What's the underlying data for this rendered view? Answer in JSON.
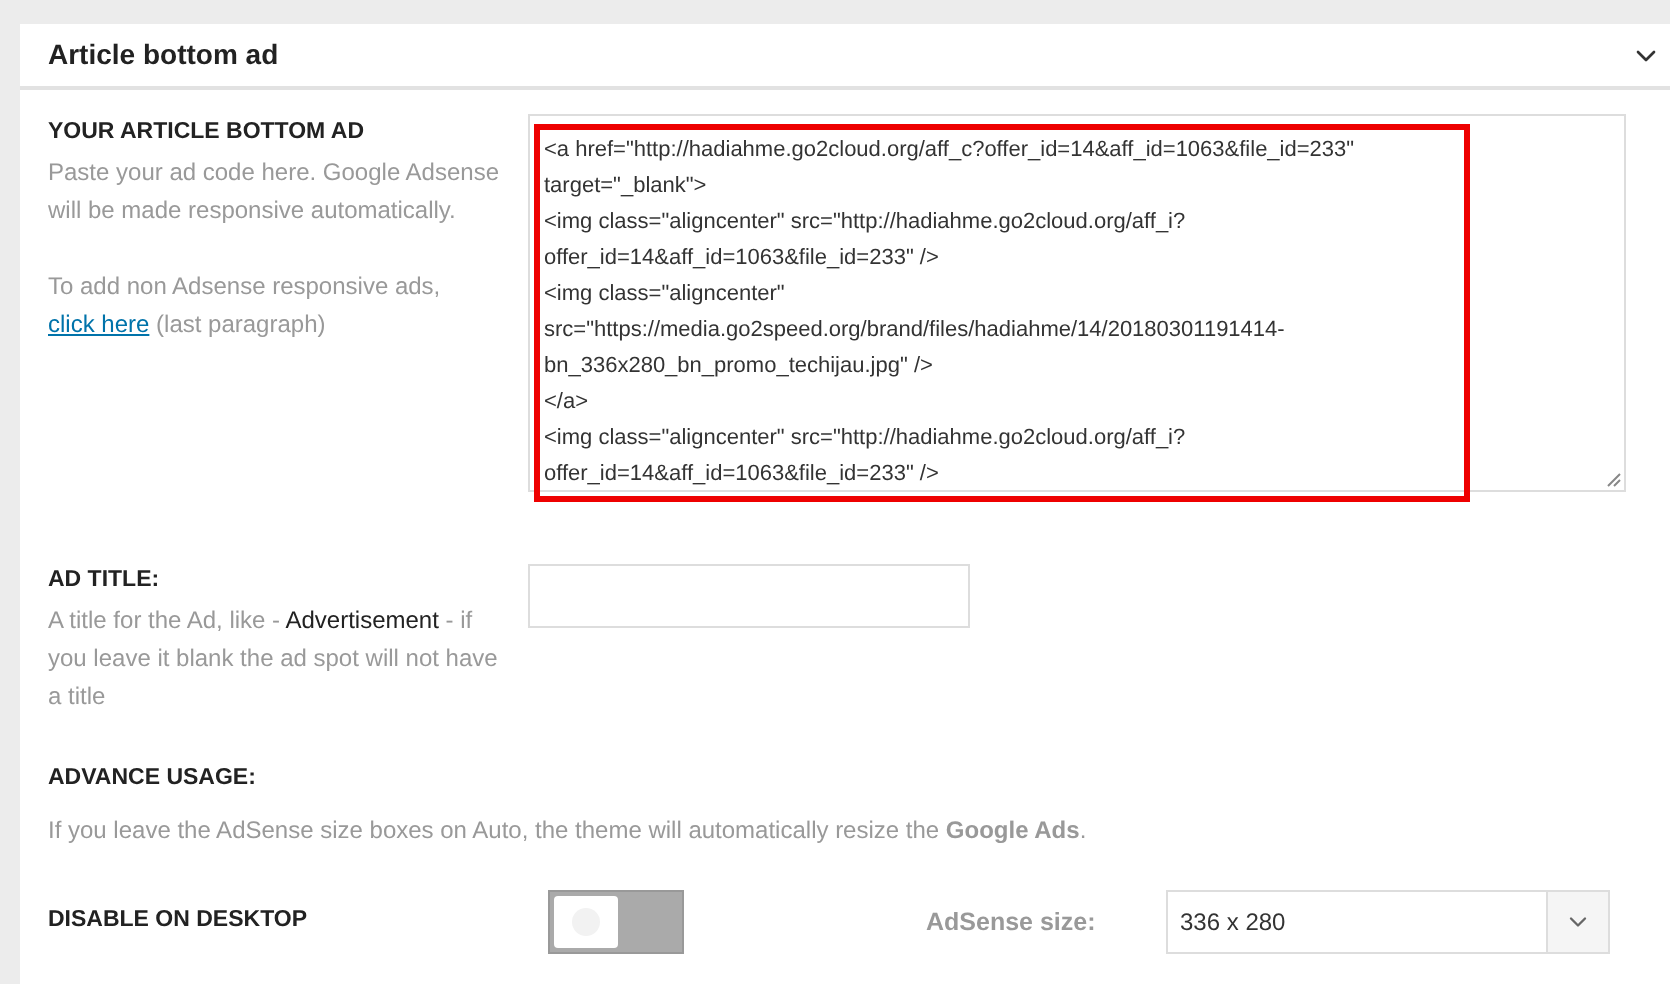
{
  "panel": {
    "title": "Article bottom ad",
    "expanded": true
  },
  "ad_code": {
    "label": "YOUR ARTICLE BOTTOM AD",
    "description": "Paste your ad code here. Google Adsense will be made responsive automatically.",
    "note": "To add non Adsense responsive ads,",
    "link": "click here",
    "note_tail": "(last paragraph)",
    "highlighted": true,
    "lines": [
      "<a href=\"http://hadiahme.go2cloud.org/aff_c?offer_id=14&aff_id=1063&file_id=233\" target=\"_blank\">",
      "<img class=\"aligncenter\" src=\"http://hadiahme.go2cloud.org/aff_i?offer_id=14&aff_id=1063&file_id=233\" />",
      "<img class=\"aligncenter\" src=\"https://media.go2speed.org/brand/files/hadiahme/14/20180301191414-bn_336x280_bn_promo_techijau.jpg\"  />",
      "</a>",
      "<img class=\"aligncenter\" src=\"http://hadiahme.go2cloud.org/aff_i?offer_id=14&aff_id=1063&file_id=233\" />"
    ]
  },
  "ad_title": {
    "label": "AD TITLE:",
    "description": "A title for the Ad, like - **Advertisement** - if you leave it blank the ad spot will not have a title"
  },
  "advance_usage": {
    "label": "ADVANCE USAGE:",
    "description": "If you leave the AdSense size boxes on Auto, the theme will automatically resize the **Google Ads**."
  },
  "disable_desktop": {
    "label": "DISABLE ON DESKTOP",
    "on": false,
    "size_label": "AdSense size:",
    "size_value": "336 x 280"
  }
}
